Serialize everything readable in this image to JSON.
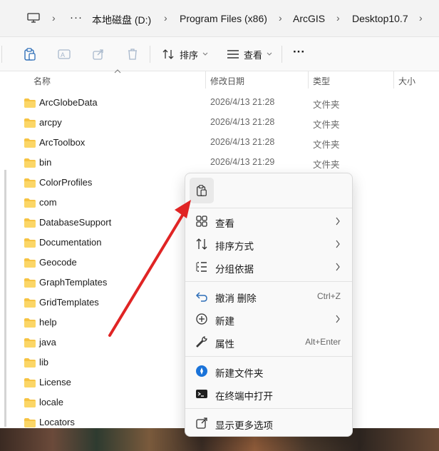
{
  "address": {
    "crumbs": [
      "本地磁盘 (D:)",
      "Program Files (x86)",
      "ArcGIS",
      "Desktop10.7"
    ],
    "more": "···"
  },
  "toolbar": {
    "sort_label": "排序",
    "view_label": "查看",
    "more_label": "···"
  },
  "columns": {
    "name": "名称",
    "date": "修改日期",
    "type": "类型",
    "size": "大小"
  },
  "files": [
    {
      "name": "ArcGlobeData",
      "date": "2026/4/13 21:28",
      "type": "文件夹"
    },
    {
      "name": "arcpy",
      "date": "2026/4/13 21:28",
      "type": "文件夹"
    },
    {
      "name": "ArcToolbox",
      "date": "2026/4/13 21:28",
      "type": "文件夹"
    },
    {
      "name": "bin",
      "date": "2026/4/13 21:29",
      "type": "文件夹"
    },
    {
      "name": "ColorProfiles",
      "date": "",
      "type": ""
    },
    {
      "name": "com",
      "date": "",
      "type": ""
    },
    {
      "name": "DatabaseSupport",
      "date": "",
      "type": ""
    },
    {
      "name": "Documentation",
      "date": "",
      "type": ""
    },
    {
      "name": "Geocode",
      "date": "",
      "type": ""
    },
    {
      "name": "GraphTemplates",
      "date": "",
      "type": ""
    },
    {
      "name": "GridTemplates",
      "date": "",
      "type": ""
    },
    {
      "name": "help",
      "date": "",
      "type": ""
    },
    {
      "name": "java",
      "date": "",
      "type": ""
    },
    {
      "name": "lib",
      "date": "",
      "type": ""
    },
    {
      "name": "License",
      "date": "",
      "type": ""
    },
    {
      "name": "locale",
      "date": "",
      "type": ""
    },
    {
      "name": "Locators",
      "date": "",
      "type": ""
    }
  ],
  "context_menu": {
    "items": [
      {
        "label": "查看",
        "shortcut": "",
        "submenu": true,
        "icon": "grid-view-icon"
      },
      {
        "label": "排序方式",
        "shortcut": "",
        "submenu": true,
        "icon": "sort-icon"
      },
      {
        "label": "分组依据",
        "shortcut": "",
        "submenu": true,
        "icon": "group-by-icon"
      },
      {
        "label": "撤消 删除",
        "shortcut": "Ctrl+Z",
        "submenu": false,
        "icon": "undo-icon"
      },
      {
        "label": "新建",
        "shortcut": "",
        "submenu": true,
        "icon": "new-icon"
      },
      {
        "label": "属性",
        "shortcut": "Alt+Enter",
        "submenu": false,
        "icon": "wrench-icon"
      },
      {
        "label": "新建文件夹",
        "shortcut": "",
        "submenu": false,
        "icon": "new-folder-icon"
      },
      {
        "label": "在终端中打开",
        "shortcut": "",
        "submenu": false,
        "icon": "terminal-icon"
      },
      {
        "label": "显示更多选项",
        "shortcut": "",
        "submenu": false,
        "icon": "show-more-icon"
      }
    ]
  },
  "colors": {
    "folder": "#f6c343",
    "arrow": "#e02424",
    "accent": "#0067c0"
  }
}
